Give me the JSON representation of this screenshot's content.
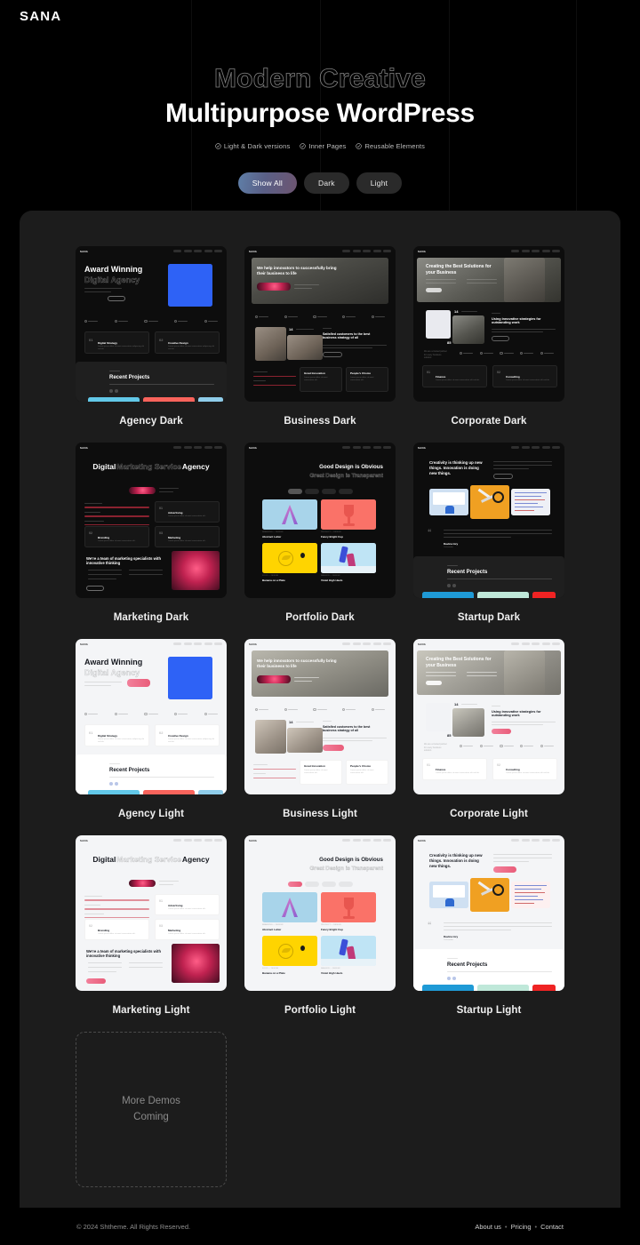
{
  "brand": {
    "logo": "SANA"
  },
  "hero": {
    "title_outline": "Modern Creative",
    "title_solid": "Multipurpose WordPress",
    "features": [
      {
        "icon": "check-circle-icon",
        "label": "Light & Dark versions"
      },
      {
        "icon": "check-circle-icon",
        "label": "Inner Pages"
      },
      {
        "icon": "check-circle-icon",
        "label": "Reusable Elements"
      }
    ],
    "filters": [
      {
        "label": "Show All",
        "active": true
      },
      {
        "label": "Dark",
        "active": false
      },
      {
        "label": "Light",
        "active": false
      }
    ]
  },
  "demos": [
    {
      "label": "Agency Dark",
      "theme": "dark",
      "heading_solid": "Award Winning",
      "heading_ghost": "Digital Agency",
      "section_title": "Recent Projects",
      "cards": [
        {
          "num": "01",
          "title": "Digital Strategy"
        },
        {
          "num": "02",
          "title": "Creative Design"
        }
      ]
    },
    {
      "label": "Business Dark",
      "theme": "dark",
      "heading_solid": "We help innovators to successfully bring their business to life",
      "section_title": "Satisfied customers to the best business strategy of all",
      "cards": [
        {
          "num": "",
          "title": "Great Innovation"
        },
        {
          "num": "",
          "title": "People's Choice"
        }
      ]
    },
    {
      "label": "Corporate Dark",
      "theme": "dark",
      "heading_solid": "Creating the Best Solutions for your Business",
      "section_title": "Using innovative strategies for outstanding work",
      "stat": "85",
      "cards": [
        {
          "num": "01",
          "title": "Finance"
        },
        {
          "num": "02",
          "title": "Consulting"
        }
      ]
    },
    {
      "label": "Marketing Dark",
      "theme": "dark",
      "heading_solid": "Digital",
      "heading_ghost": "Marketing Service",
      "heading_solid2": "Agency",
      "section_title": "We're a team of marketing specialists with innovative thinking",
      "cards": [
        {
          "num": "01",
          "title": "Advertising"
        },
        {
          "num": "02",
          "title": "Branding"
        },
        {
          "num": "03",
          "title": "Marketing"
        }
      ]
    },
    {
      "label": "Portfolio Dark",
      "theme": "dark",
      "heading_solid": "Good Design is Obvious",
      "heading_ghost": "Great Design is Transparent",
      "tiles": [
        {
          "title": "Abstract Letter"
        },
        {
          "title": "Fancy Bright Cup"
        },
        {
          "title": "Banana on a Plate"
        },
        {
          "title": "Violet High Heels"
        }
      ]
    },
    {
      "label": "Startup Dark",
      "theme": "dark",
      "heading_solid": "Creativity is thinking up new things. Innovation is doing new things.",
      "section_title": "Recent Projects",
      "quote_author": "Davina Izzy"
    },
    {
      "label": "Agency Light",
      "theme": "light",
      "heading_solid": "Award Winning",
      "heading_ghost": "Digital Agency",
      "section_title": "Recent Projects",
      "cards": [
        {
          "num": "01",
          "title": "Digital Strategy"
        },
        {
          "num": "02",
          "title": "Creative Design"
        }
      ]
    },
    {
      "label": "Business Light",
      "theme": "light",
      "heading_solid": "We help innovators to successfully bring their business to life",
      "section_title": "Satisfied customers to the best business strategy of all",
      "cards": [
        {
          "num": "",
          "title": "Great Innovation"
        },
        {
          "num": "",
          "title": "People's Choice"
        }
      ]
    },
    {
      "label": "Corporate Light",
      "theme": "light",
      "heading_solid": "Creating the Best Solutions for your Business",
      "section_title": "Using innovative strategies for outstanding work",
      "stat": "85",
      "cards": [
        {
          "num": "01",
          "title": "Finance"
        },
        {
          "num": "02",
          "title": "Consulting"
        }
      ]
    },
    {
      "label": "Marketing Light",
      "theme": "light",
      "heading_solid": "Digital",
      "heading_ghost": "Marketing Service",
      "heading_solid2": "Agency",
      "section_title": "We're a team of marketing specialists with innovative thinking",
      "cards": [
        {
          "num": "01",
          "title": "Advertising"
        },
        {
          "num": "02",
          "title": "Branding"
        },
        {
          "num": "03",
          "title": "Marketing"
        }
      ]
    },
    {
      "label": "Portfolio Light",
      "theme": "light",
      "heading_solid": "Good Design is Obvious",
      "heading_ghost": "Great Design is Transparent",
      "tiles": [
        {
          "title": "Abstract Letter"
        },
        {
          "title": "Fancy Bright Cup"
        },
        {
          "title": "Banana on a Plate"
        },
        {
          "title": "Violet High Heels"
        }
      ]
    },
    {
      "label": "Startup Light",
      "theme": "light",
      "heading_solid": "Creativity is thinking up new things. Innovation is doing new things.",
      "section_title": "Recent Projects",
      "quote_author": "Davina Izzy"
    }
  ],
  "coming_soon": {
    "line1": "More Demos",
    "line2": "Coming"
  },
  "footer": {
    "copyright": "© 2024 Shtheme. All Rights Reserved.",
    "links": [
      "About us",
      "Pricing",
      "Contact"
    ],
    "separator": "•"
  },
  "colors": {
    "page_bg": "#000000",
    "panel_bg": "#1c1c1c",
    "accent_active": "#5f7fa8",
    "text_primary": "#ffffff",
    "text_muted": "#8f8f8f"
  }
}
